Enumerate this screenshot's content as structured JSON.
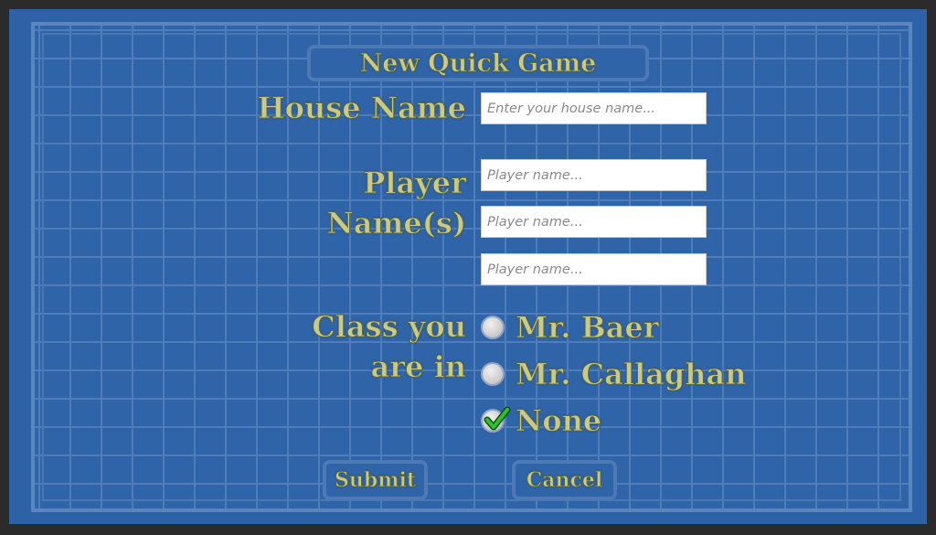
{
  "title": "New Quick Game",
  "house": {
    "label": "House Name",
    "placeholder": "Enter your house name...",
    "value": ""
  },
  "players": {
    "label_line1": "Player",
    "label_line2": "Name(s)",
    "fields": [
      {
        "placeholder": "Player name...",
        "value": ""
      },
      {
        "placeholder": "Player name...",
        "value": ""
      },
      {
        "placeholder": "Player name...",
        "value": ""
      }
    ]
  },
  "class_choice": {
    "label_line1": "Class you",
    "label_line2": "are in",
    "options": [
      {
        "label": "Mr. Baer",
        "selected": false
      },
      {
        "label": "Mr. Callaghan",
        "selected": false
      },
      {
        "label": "None",
        "selected": true
      }
    ]
  },
  "buttons": {
    "submit": "Submit",
    "cancel": "Cancel"
  },
  "colors": {
    "background": "#2f64a9",
    "grid_line": "#4f7db9",
    "text": "#c9c98a",
    "check": "#1fa51f"
  },
  "icons": {
    "selected_mark": "checkmark-icon"
  }
}
